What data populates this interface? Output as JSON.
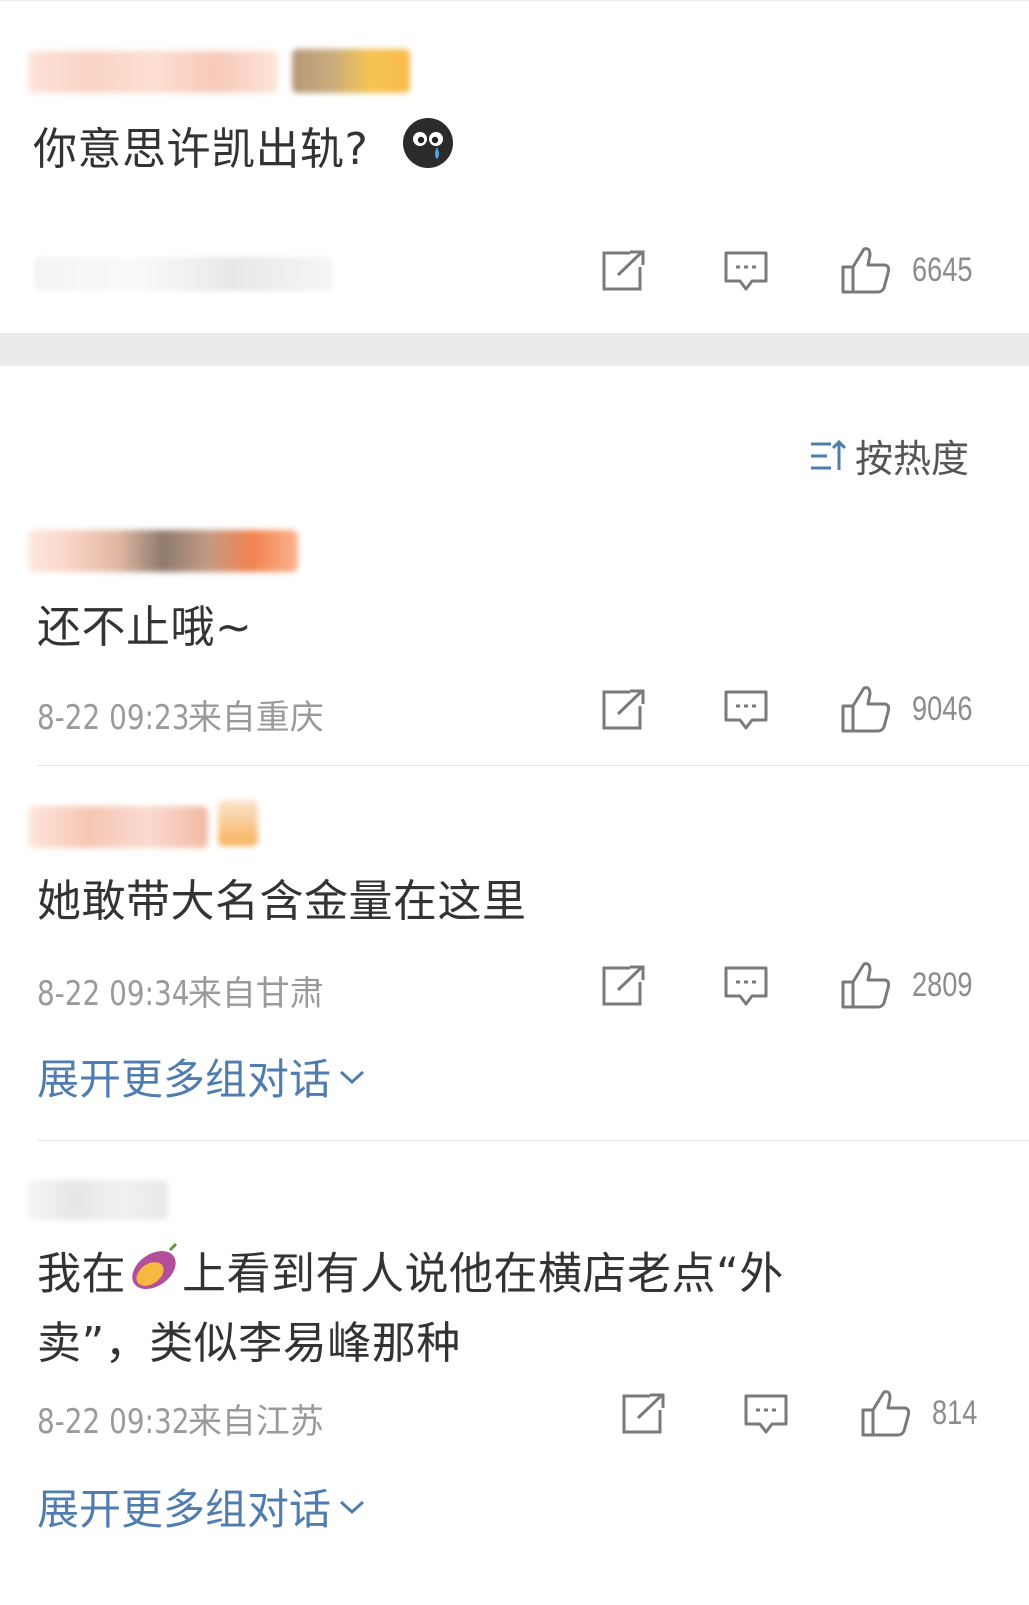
{
  "top_post": {
    "text": "你意思许凯出轨?",
    "emoji": "cry-emoji",
    "like_count": "6645"
  },
  "sort": {
    "label": "按热度",
    "icon": "sort-icon"
  },
  "comments": [
    {
      "text": "还不止哦~",
      "time": "8-22 09:23",
      "location": "来自重庆",
      "like_count": "9046"
    },
    {
      "text": "她敢带大名含金量在这里",
      "time": "8-22 09:34",
      "location": "来自甘肃",
      "like_count": "2809",
      "expand_label": "展开更多组对话"
    },
    {
      "text_line1_a": "我在",
      "text_line1_b": "上看到有人说他在横店老点“外",
      "text_line2": "卖”，类似李易峰那种",
      "time": "8-22 09:32",
      "location": "来自江苏",
      "like_count": "814",
      "expand_label": "展开更多组对话"
    }
  ],
  "icons": {
    "share": "share-icon",
    "comment": "comment-icon",
    "like": "thumbs-up-icon",
    "expand": "chevron-down-icon"
  },
  "colors": {
    "link": "#507daf",
    "meta": "#9a9a9a",
    "separator": "#ebebeb"
  }
}
